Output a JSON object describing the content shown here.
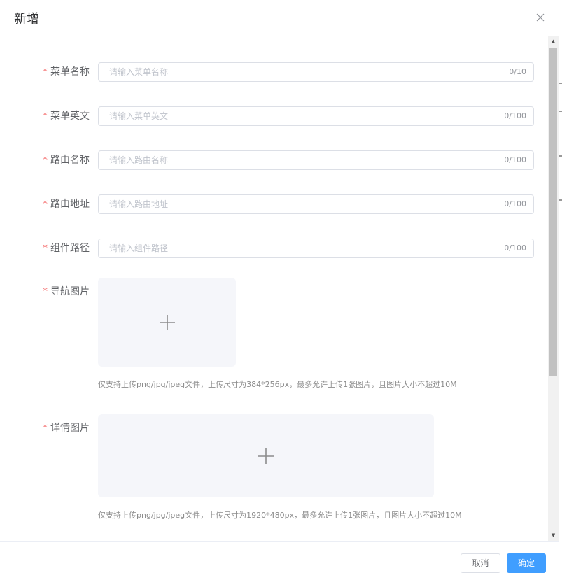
{
  "dialog": {
    "title": "新增",
    "close_icon": "close-icon"
  },
  "form": {
    "required_mark": "*",
    "fields": [
      {
        "label": "菜单名称",
        "placeholder": "请输入菜单名称",
        "count": "0/10"
      },
      {
        "label": "菜单英文",
        "placeholder": "请输入菜单英文",
        "count": "0/100"
      },
      {
        "label": "路由名称",
        "placeholder": "请输入路由名称",
        "count": "0/100"
      },
      {
        "label": "路由地址",
        "placeholder": "请输入路由地址",
        "count": "0/100"
      },
      {
        "label": "组件路径",
        "placeholder": "请输入组件路径",
        "count": "0/100"
      }
    ],
    "nav_image": {
      "label": "导航图片",
      "icon": "plus-icon",
      "hint": "仅支持上传png/jpg/jpeg文件，上传尺寸为384*256px，最多允许上传1张图片，且图片大小不超过10M"
    },
    "detail_image": {
      "label": "详情图片",
      "icon": "plus-icon",
      "hint": "仅支持上传png/jpg/jpeg文件，上传尺寸为1920*480px，最多允许上传1张图片，且图片大小不超过10M"
    }
  },
  "footer": {
    "cancel_label": "取消",
    "confirm_label": "确定"
  },
  "colors": {
    "required": "#f56c6c",
    "primary": "#409eff",
    "upload_bg": "#f5f6fa"
  }
}
